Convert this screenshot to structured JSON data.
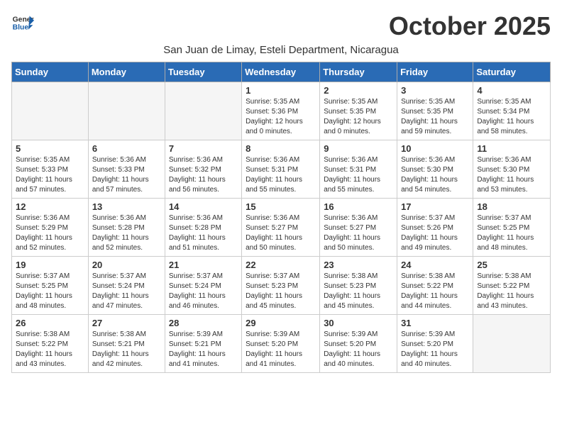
{
  "header": {
    "logo_general": "General",
    "logo_blue": "Blue",
    "month_title": "October 2025",
    "subtitle": "San Juan de Limay, Esteli Department, Nicaragua"
  },
  "weekdays": [
    "Sunday",
    "Monday",
    "Tuesday",
    "Wednesday",
    "Thursday",
    "Friday",
    "Saturday"
  ],
  "weeks": [
    [
      {
        "day": "",
        "info": ""
      },
      {
        "day": "",
        "info": ""
      },
      {
        "day": "",
        "info": ""
      },
      {
        "day": "1",
        "info": "Sunrise: 5:35 AM\nSunset: 5:36 PM\nDaylight: 12 hours\nand 0 minutes."
      },
      {
        "day": "2",
        "info": "Sunrise: 5:35 AM\nSunset: 5:35 PM\nDaylight: 12 hours\nand 0 minutes."
      },
      {
        "day": "3",
        "info": "Sunrise: 5:35 AM\nSunset: 5:35 PM\nDaylight: 11 hours\nand 59 minutes."
      },
      {
        "day": "4",
        "info": "Sunrise: 5:35 AM\nSunset: 5:34 PM\nDaylight: 11 hours\nand 58 minutes."
      }
    ],
    [
      {
        "day": "5",
        "info": "Sunrise: 5:35 AM\nSunset: 5:33 PM\nDaylight: 11 hours\nand 57 minutes."
      },
      {
        "day": "6",
        "info": "Sunrise: 5:36 AM\nSunset: 5:33 PM\nDaylight: 11 hours\nand 57 minutes."
      },
      {
        "day": "7",
        "info": "Sunrise: 5:36 AM\nSunset: 5:32 PM\nDaylight: 11 hours\nand 56 minutes."
      },
      {
        "day": "8",
        "info": "Sunrise: 5:36 AM\nSunset: 5:31 PM\nDaylight: 11 hours\nand 55 minutes."
      },
      {
        "day": "9",
        "info": "Sunrise: 5:36 AM\nSunset: 5:31 PM\nDaylight: 11 hours\nand 55 minutes."
      },
      {
        "day": "10",
        "info": "Sunrise: 5:36 AM\nSunset: 5:30 PM\nDaylight: 11 hours\nand 54 minutes."
      },
      {
        "day": "11",
        "info": "Sunrise: 5:36 AM\nSunset: 5:30 PM\nDaylight: 11 hours\nand 53 minutes."
      }
    ],
    [
      {
        "day": "12",
        "info": "Sunrise: 5:36 AM\nSunset: 5:29 PM\nDaylight: 11 hours\nand 52 minutes."
      },
      {
        "day": "13",
        "info": "Sunrise: 5:36 AM\nSunset: 5:28 PM\nDaylight: 11 hours\nand 52 minutes."
      },
      {
        "day": "14",
        "info": "Sunrise: 5:36 AM\nSunset: 5:28 PM\nDaylight: 11 hours\nand 51 minutes."
      },
      {
        "day": "15",
        "info": "Sunrise: 5:36 AM\nSunset: 5:27 PM\nDaylight: 11 hours\nand 50 minutes."
      },
      {
        "day": "16",
        "info": "Sunrise: 5:36 AM\nSunset: 5:27 PM\nDaylight: 11 hours\nand 50 minutes."
      },
      {
        "day": "17",
        "info": "Sunrise: 5:37 AM\nSunset: 5:26 PM\nDaylight: 11 hours\nand 49 minutes."
      },
      {
        "day": "18",
        "info": "Sunrise: 5:37 AM\nSunset: 5:25 PM\nDaylight: 11 hours\nand 48 minutes."
      }
    ],
    [
      {
        "day": "19",
        "info": "Sunrise: 5:37 AM\nSunset: 5:25 PM\nDaylight: 11 hours\nand 48 minutes."
      },
      {
        "day": "20",
        "info": "Sunrise: 5:37 AM\nSunset: 5:24 PM\nDaylight: 11 hours\nand 47 minutes."
      },
      {
        "day": "21",
        "info": "Sunrise: 5:37 AM\nSunset: 5:24 PM\nDaylight: 11 hours\nand 46 minutes."
      },
      {
        "day": "22",
        "info": "Sunrise: 5:37 AM\nSunset: 5:23 PM\nDaylight: 11 hours\nand 45 minutes."
      },
      {
        "day": "23",
        "info": "Sunrise: 5:38 AM\nSunset: 5:23 PM\nDaylight: 11 hours\nand 45 minutes."
      },
      {
        "day": "24",
        "info": "Sunrise: 5:38 AM\nSunset: 5:22 PM\nDaylight: 11 hours\nand 44 minutes."
      },
      {
        "day": "25",
        "info": "Sunrise: 5:38 AM\nSunset: 5:22 PM\nDaylight: 11 hours\nand 43 minutes."
      }
    ],
    [
      {
        "day": "26",
        "info": "Sunrise: 5:38 AM\nSunset: 5:22 PM\nDaylight: 11 hours\nand 43 minutes."
      },
      {
        "day": "27",
        "info": "Sunrise: 5:38 AM\nSunset: 5:21 PM\nDaylight: 11 hours\nand 42 minutes."
      },
      {
        "day": "28",
        "info": "Sunrise: 5:39 AM\nSunset: 5:21 PM\nDaylight: 11 hours\nand 41 minutes."
      },
      {
        "day": "29",
        "info": "Sunrise: 5:39 AM\nSunset: 5:20 PM\nDaylight: 11 hours\nand 41 minutes."
      },
      {
        "day": "30",
        "info": "Sunrise: 5:39 AM\nSunset: 5:20 PM\nDaylight: 11 hours\nand 40 minutes."
      },
      {
        "day": "31",
        "info": "Sunrise: 5:39 AM\nSunset: 5:20 PM\nDaylight: 11 hours\nand 40 minutes."
      },
      {
        "day": "",
        "info": ""
      }
    ]
  ]
}
